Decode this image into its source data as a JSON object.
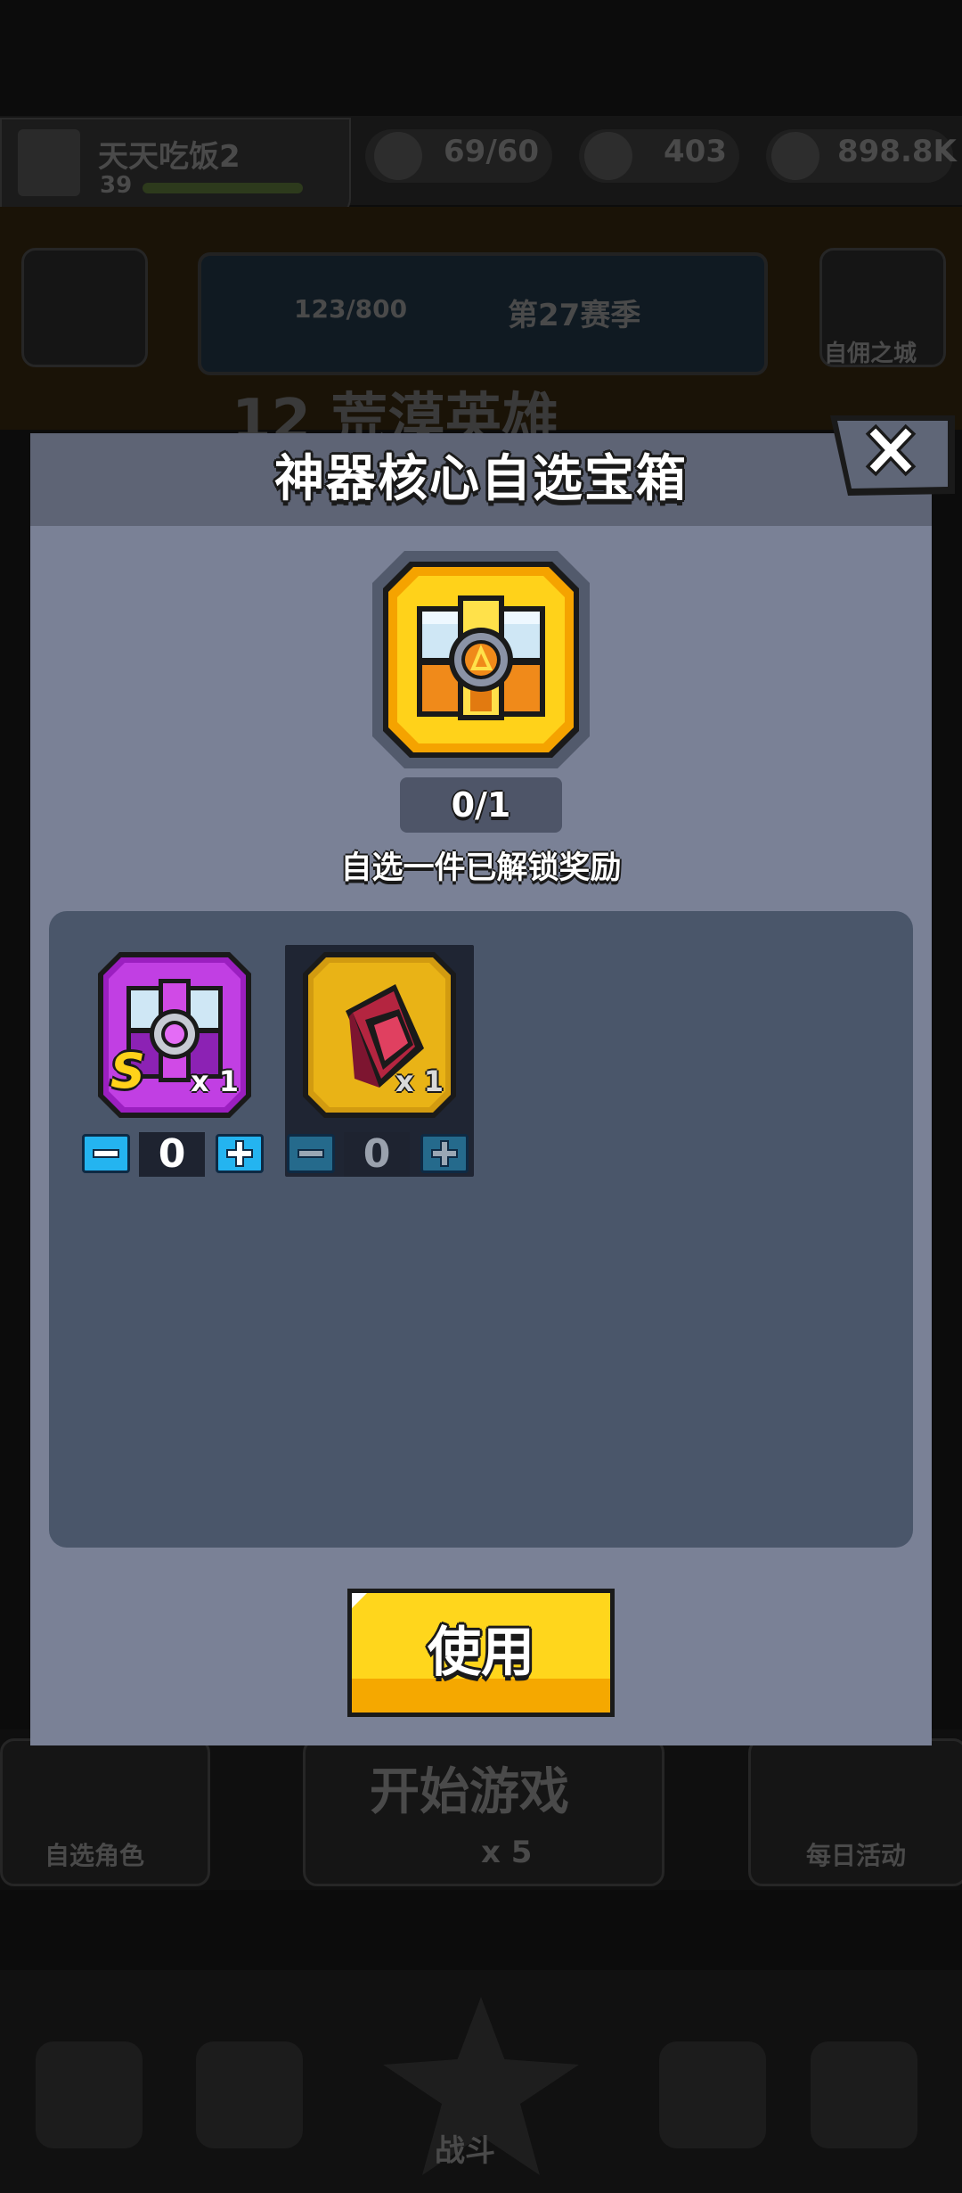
{
  "background": {
    "player_name": "天天吃饭2",
    "player_level": "39",
    "energy": "69/60",
    "gems": "403",
    "coins": "898.8K",
    "trophy_progress": "123/800",
    "season_label": "第27赛季",
    "stage_title": "12 荒漠英雄",
    "right_side_label": "自佣之城",
    "left_lower_label": "自选角色",
    "start_game": "开始游戏",
    "start_cost": "x 5",
    "right_lower_label": "每日活动",
    "nav_center_label": "战斗"
  },
  "modal": {
    "title": "神器核心自选宝箱",
    "counter": "0/1",
    "hint": "自选一件已解锁奖励",
    "use_button_label": "使用",
    "items": [
      {
        "name": "purple-chest",
        "grade": "S",
        "count_label": "x 1",
        "quantity": "0",
        "color": "#b62dd6"
      },
      {
        "name": "red-artifact",
        "grade": "",
        "count_label": "x 1",
        "quantity": "0",
        "color": "#f2c312"
      }
    ]
  }
}
